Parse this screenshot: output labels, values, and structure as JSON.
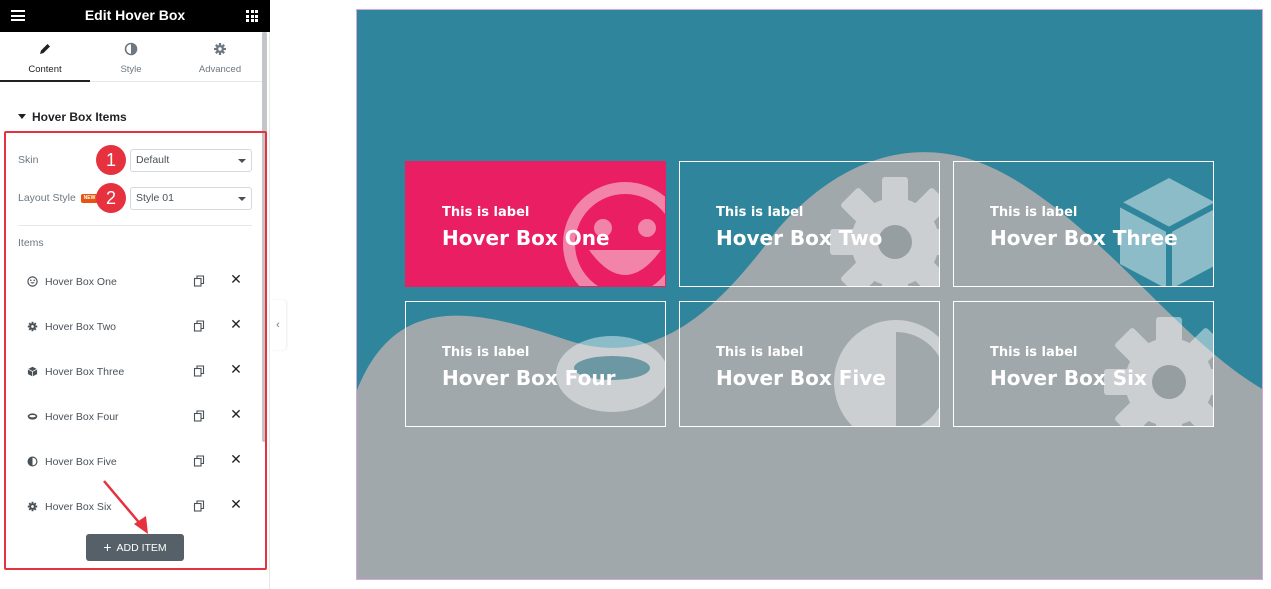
{
  "editor": {
    "title": "Edit Hover Box",
    "tabs": [
      {
        "label": "Content",
        "icon": "pencil-icon",
        "active": true
      },
      {
        "label": "Style",
        "icon": "half-circle-icon",
        "active": false
      },
      {
        "label": "Advanced",
        "icon": "gear-icon",
        "active": false
      }
    ],
    "section_title": "Hover Box Items",
    "skin": {
      "label": "Skin",
      "value": "Default",
      "step": "1"
    },
    "layout_style": {
      "label": "Layout Style",
      "badge": "NEW",
      "value": "Style 01",
      "step": "2"
    },
    "items_label": "Items",
    "items": [
      {
        "name": "Hover Box One",
        "icon": "smile-icon"
      },
      {
        "name": "Hover Box Two",
        "icon": "gear-icon"
      },
      {
        "name": "Hover Box Three",
        "icon": "cube-icon"
      },
      {
        "name": "Hover Box Four",
        "icon": "ring-icon"
      },
      {
        "name": "Hover Box Five",
        "icon": "half-circle-icon"
      },
      {
        "name": "Hover Box Six",
        "icon": "gear-icon"
      }
    ],
    "add_item_label": "ADD ITEM",
    "collapse_glyph": "‹"
  },
  "preview": {
    "background_color": "#2e859c",
    "wave_color": "#a0a8ab",
    "active_color": "#e91e63",
    "boxes": [
      {
        "label": "This is label",
        "title": "Hover Box One",
        "icon": "smile-icon",
        "active": true
      },
      {
        "label": "This is label",
        "title": "Hover Box Two",
        "icon": "gear-icon",
        "active": false
      },
      {
        "label": "This is label",
        "title": "Hover Box Three",
        "icon": "cube-icon",
        "active": false
      },
      {
        "label": "This is label",
        "title": "Hover Box Four",
        "icon": "ring-icon",
        "active": false
      },
      {
        "label": "This is label",
        "title": "Hover Box Five",
        "icon": "half-circle-icon",
        "active": false
      },
      {
        "label": "This is label",
        "title": "Hover Box Six",
        "icon": "gear-icon",
        "active": false
      }
    ]
  }
}
